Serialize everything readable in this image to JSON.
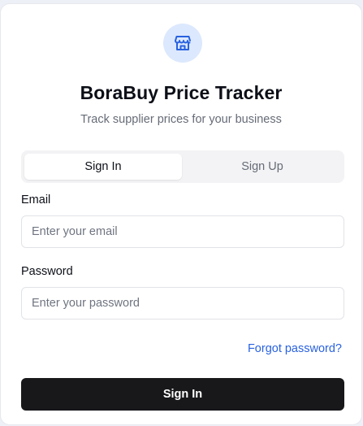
{
  "brand": {
    "icon": "store-icon",
    "title": "BoraBuy Price Tracker",
    "subtitle": "Track supplier prices for your business"
  },
  "tabs": [
    {
      "label": "Sign In",
      "active": true
    },
    {
      "label": "Sign Up",
      "active": false
    }
  ],
  "form": {
    "email": {
      "label": "Email",
      "value": "",
      "placeholder": "Enter your email"
    },
    "password": {
      "label": "Password",
      "value": "",
      "placeholder": "Enter your password"
    },
    "forgot_label": "Forgot password?",
    "submit_label": "Sign In"
  },
  "colors": {
    "accent": "#2962e0",
    "icon_bg": "#dce8fd",
    "button_bg": "#18181b"
  }
}
